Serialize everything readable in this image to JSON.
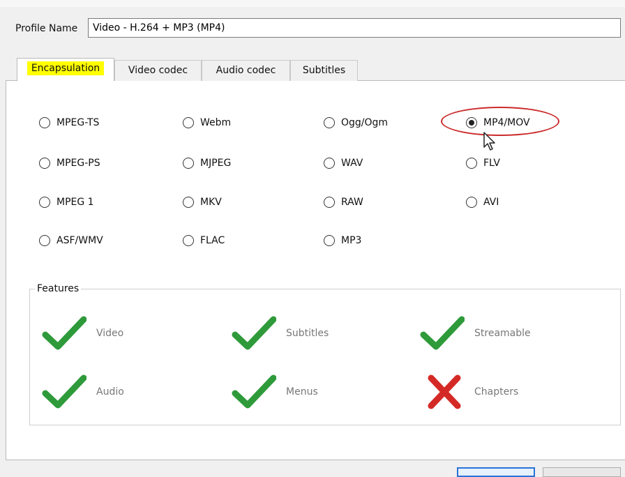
{
  "profile": {
    "label": "Profile Name",
    "value": "Video - H.264 + MP3 (MP4)"
  },
  "tabs": [
    {
      "label": "Encapsulation",
      "active": true
    },
    {
      "label": "Video codec",
      "active": false
    },
    {
      "label": "Audio codec",
      "active": false
    },
    {
      "label": "Subtitles",
      "active": false
    }
  ],
  "formats": {
    "mpeg_ts": "MPEG-TS",
    "webm": "Webm",
    "ogg": "Ogg/Ogm",
    "mp4": "MP4/MOV",
    "mpeg_ps": "MPEG-PS",
    "mjpeg": "MJPEG",
    "wav": "WAV",
    "flv": "FLV",
    "mpeg1": "MPEG 1",
    "mkv": "MKV",
    "raw": "RAW",
    "avi": "AVI",
    "asf": "ASF/WMV",
    "flac": "FLAC",
    "mp3": "MP3",
    "selected": "MP4/MOV"
  },
  "features": {
    "title": "Features",
    "video": {
      "label": "Video",
      "supported": true
    },
    "subtitles": {
      "label": "Subtitles",
      "supported": true
    },
    "streamable": {
      "label": "Streamable",
      "supported": true
    },
    "audio": {
      "label": "Audio",
      "supported": true
    },
    "menus": {
      "label": "Menus",
      "supported": true
    },
    "chapters": {
      "label": "Chapters",
      "supported": false
    }
  },
  "colors": {
    "check": "#2e9a3a",
    "cross": "#d42a25",
    "highlight": "#ffff00",
    "annotation": "#cc2a2a"
  }
}
